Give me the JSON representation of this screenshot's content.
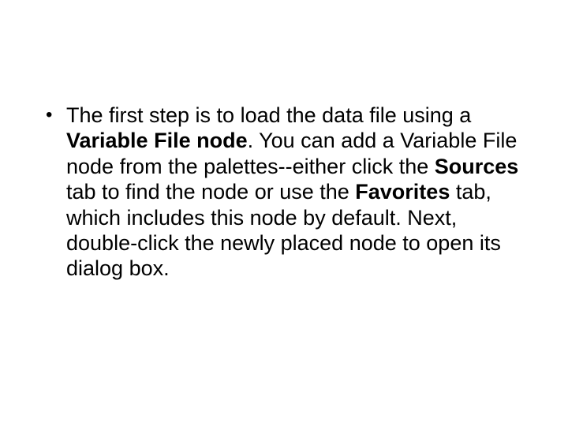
{
  "slide": {
    "bullet1": {
      "seg1": "The first step is to load the data file using a ",
      "seg2_bold": "Variable File node",
      "seg3": ". You can add a Variable File node from the palettes--either click the ",
      "seg4_bold": "Sources",
      "seg5": " tab to find the node or use the ",
      "seg6_bold": "Favorites",
      "seg7": " tab, which includes this node by default. Next, double-click the newly placed node to open its dialog box."
    }
  }
}
